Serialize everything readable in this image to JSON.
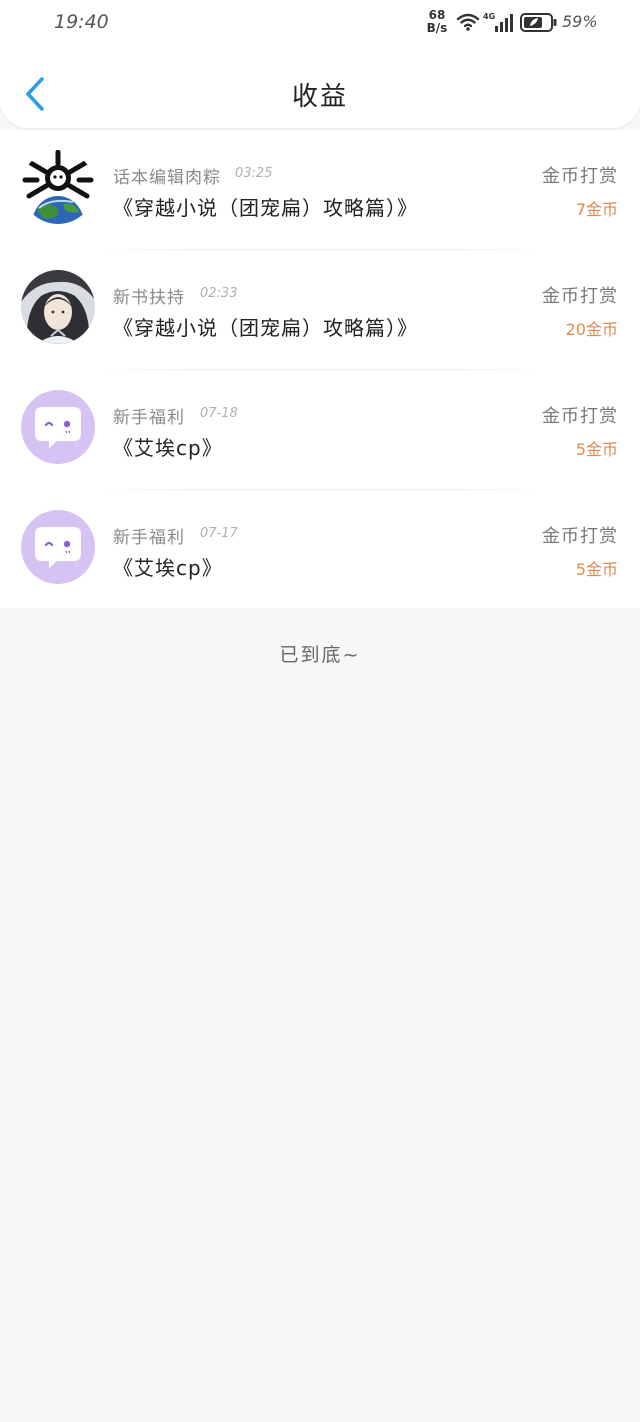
{
  "status_bar": {
    "time": "19:40",
    "net_speed_value": "68",
    "net_speed_unit": "B/s",
    "network_type": "4G",
    "battery": "59%"
  },
  "header": {
    "title": "收益",
    "back_icon": "chevron-left-icon"
  },
  "colors": {
    "accent_blue": "#2a9de8",
    "amount_orange": "#e08a4a"
  },
  "records": [
    {
      "avatar": "skull-globe-avatar",
      "source": "话本编辑肉粽",
      "time": "03:25",
      "book": "《穿越小说（团宠扁）攻略篇）》",
      "type": "金币打赏",
      "amount": "7金币"
    },
    {
      "avatar": "anime-character-avatar",
      "source": "新书扶持",
      "time": "02:33",
      "book": "《穿越小说（团宠扁）攻略篇）》",
      "type": "金币打赏",
      "amount": "20金币"
    },
    {
      "avatar": "chat-bubble-avatar",
      "source": "新手福利",
      "time": "07-18",
      "book": "《艾埃cp》",
      "type": "金币打赏",
      "amount": "5金币"
    },
    {
      "avatar": "chat-bubble-avatar",
      "source": "新手福利",
      "time": "07-17",
      "book": "《艾埃cp》",
      "type": "金币打赏",
      "amount": "5金币"
    }
  ],
  "footer": {
    "end_text": "已到底~"
  }
}
